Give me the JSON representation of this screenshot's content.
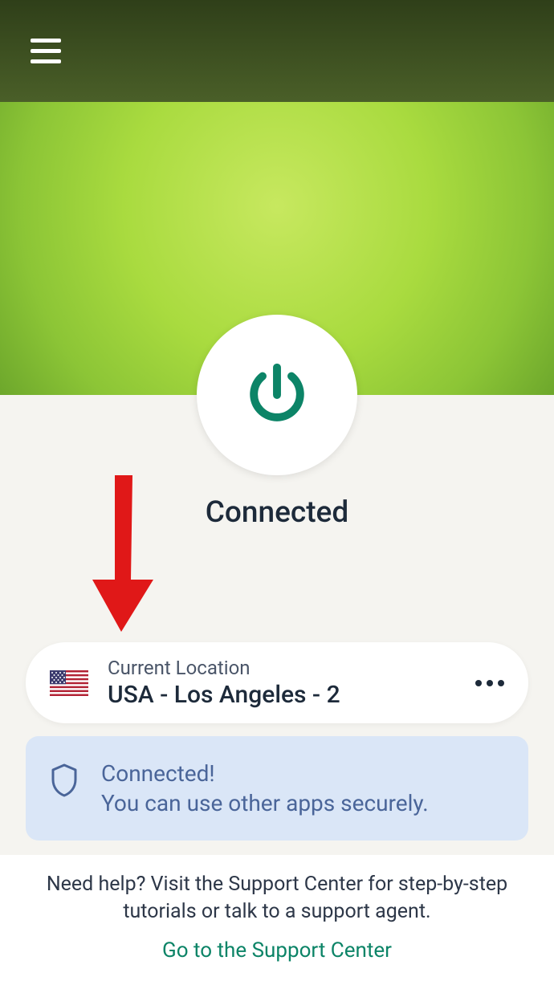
{
  "status": {
    "label": "Connected"
  },
  "location": {
    "label": "Current Location",
    "value": "USA - Los Angeles - 2",
    "country": "USA",
    "flag": "us"
  },
  "banner": {
    "title": "Connected!",
    "subtitle": "You can use other apps securely."
  },
  "help": {
    "text": "Need help? Visit the Support Center for step-by-step tutorials or talk to a support agent.",
    "link": "Go to the Support Center"
  }
}
